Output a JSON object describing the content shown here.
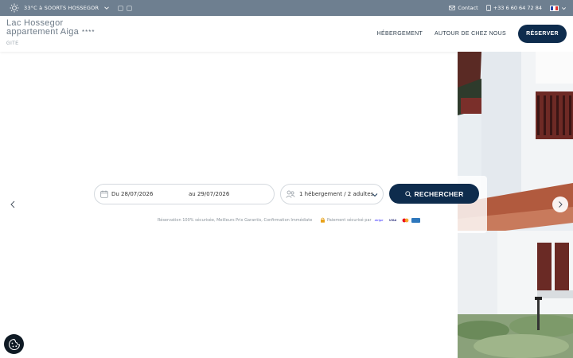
{
  "topbar": {
    "weather": "33°C à SOORTS HOSSEGOR",
    "contact": "Contact",
    "phone": "+33 6 60 64 72 84",
    "icons": [
      "sun-icon",
      "chevron-down-icon",
      "facebook-icon",
      "instagram-icon",
      "mail-icon",
      "phone-icon",
      "french-flag-icon"
    ]
  },
  "header": {
    "title_line1": "Lac Hossegor",
    "title_line2": "appartement Aiga",
    "stars": "****",
    "category": "GITE",
    "nav": {
      "hebergement": "HÉBERGEMENT",
      "autour": "AUTOUR DE CHEZ NOUS"
    },
    "reserve": "RÉSERVER"
  },
  "booking": {
    "date_from": "Du 28/07/2026",
    "date_to": "au 29/07/2026",
    "guests": "1 hébergement / 2 adultes",
    "search": "RECHERCHER",
    "guarantee": "Réservation 100% sécurisée, Meilleurs Prix Garantis, Confirmation Immédiate",
    "secure": "Paiement sécurisé par",
    "payment_brands": [
      "stripe",
      "VISA",
      "mastercard",
      "amex"
    ]
  },
  "colors": {
    "topbar": "#6e7f90",
    "accent": "#0e2c4d"
  }
}
